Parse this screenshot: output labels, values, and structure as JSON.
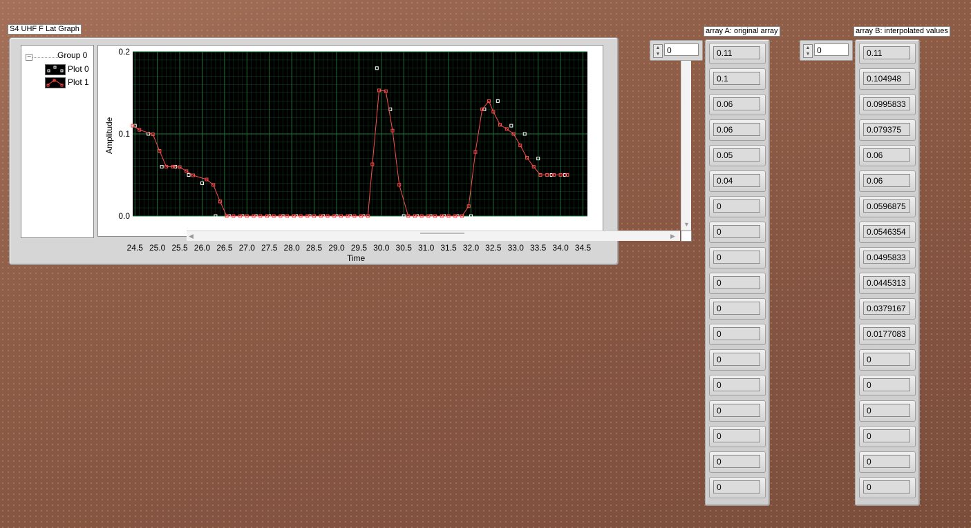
{
  "graph": {
    "label": "S4 UHF F Lat Graph",
    "legend": {
      "group": "Group 0",
      "plots": [
        "Plot 0",
        "Plot 1"
      ]
    },
    "xlabel": "Time",
    "ylabel": "Amplitude",
    "bg_color": "#000000",
    "grid_color": "#1f7a3a",
    "plot0_color": "#ffffff",
    "plot1_color": "#ff4b4b"
  },
  "chart_data": {
    "type": "line",
    "title": "S4 UHF F Lat Graph",
    "xlabel": "Time",
    "ylabel": "Amplitude",
    "xlim": [
      24.45,
      34.6
    ],
    "ylim": [
      0,
      0.2
    ],
    "x_ticks": [
      "24.5",
      "25.0",
      "25.5",
      "26.0",
      "26.5",
      "27.0",
      "27.5",
      "28.0",
      "28.5",
      "29.0",
      "29.5",
      "30.0",
      "30.5",
      "31.0",
      "31.5",
      "32.0",
      "32.5",
      "33.0",
      "33.5",
      "34.0",
      "34.5"
    ],
    "y_ticks": [
      "0.0",
      "0.1",
      "0.2"
    ],
    "grid": true,
    "series": [
      {
        "name": "Plot 0",
        "color": "#ffffff",
        "x": [
          24.5,
          24.8,
          25.1,
          25.4,
          25.7,
          26.0,
          26.3,
          26.6,
          26.9,
          27.2,
          27.5,
          27.8,
          28.1,
          28.4,
          28.7,
          29.0,
          29.3,
          29.6,
          29.9,
          30.2,
          30.5,
          30.8,
          31.1,
          31.4,
          31.7,
          32.0,
          32.3,
          32.6,
          32.9,
          33.2,
          33.5,
          33.8,
          34.1
        ],
        "y": [
          0.11,
          0.1,
          0.06,
          0.06,
          0.05,
          0.04,
          0,
          0,
          0,
          0,
          0,
          0,
          0,
          0,
          0,
          0,
          0,
          0,
          0.18,
          0.13,
          0,
          0,
          0,
          0,
          0,
          0,
          0.13,
          0.14,
          0.11,
          0.1,
          0.07,
          0.05,
          0.05
        ]
      },
      {
        "name": "Plot 1",
        "color": "#ff4b4b",
        "x": [
          24.45,
          24.6,
          24.9,
          25.05,
          25.2,
          25.35,
          25.5,
          25.65,
          25.8,
          26.1,
          26.25,
          26.4,
          26.55,
          26.7,
          26.85,
          27.0,
          27.15,
          27.3,
          27.45,
          27.6,
          27.75,
          27.9,
          28.05,
          28.2,
          28.35,
          28.5,
          28.65,
          28.8,
          28.95,
          29.1,
          29.25,
          29.4,
          29.55,
          29.7,
          29.8,
          29.95,
          30.1,
          30.25,
          30.4,
          30.6,
          30.75,
          30.9,
          31.05,
          31.2,
          31.35,
          31.5,
          31.65,
          31.8,
          31.95,
          32.1,
          32.25,
          32.4,
          32.5,
          32.65,
          32.8,
          32.95,
          33.1,
          33.25,
          33.4,
          33.55,
          33.7,
          33.85,
          34.0,
          34.15
        ],
        "y": [
          0.11,
          0.104948,
          0.0995833,
          0.079375,
          0.06,
          0.06,
          0.0596875,
          0.0546354,
          0.0495833,
          0.0445313,
          0.0379167,
          0.0177083,
          0,
          0,
          0,
          0,
          0,
          0,
          0,
          0,
          0,
          0,
          0,
          0,
          0,
          0,
          0,
          0,
          0,
          0,
          0,
          0,
          0,
          0,
          0.063,
          0.153,
          0.152,
          0.104,
          0.038,
          0,
          0,
          0,
          0,
          0,
          0,
          0,
          0,
          0,
          0.012,
          0.078,
          0.13,
          0.14,
          0.127,
          0.111,
          0.106,
          0.1,
          0.086,
          0.071,
          0.06,
          0.05,
          0.05,
          0.05,
          0.05,
          0.05
        ]
      }
    ]
  },
  "array_a": {
    "label": "array A: original array",
    "index": "0",
    "values": [
      "0.11",
      "0.1",
      "0.06",
      "0.06",
      "0.05",
      "0.04",
      "0",
      "0",
      "0",
      "0",
      "0",
      "0",
      "0",
      "0",
      "0",
      "0",
      "0",
      "0"
    ]
  },
  "array_b": {
    "label": "array B: interpolated values",
    "index": "0",
    "values": [
      "0.11",
      "0.104948",
      "0.0995833",
      "0.079375",
      "0.06",
      "0.06",
      "0.0596875",
      "0.0546354",
      "0.0495833",
      "0.0445313",
      "0.0379167",
      "0.0177083",
      "0",
      "0",
      "0",
      "0",
      "0",
      "0"
    ]
  }
}
